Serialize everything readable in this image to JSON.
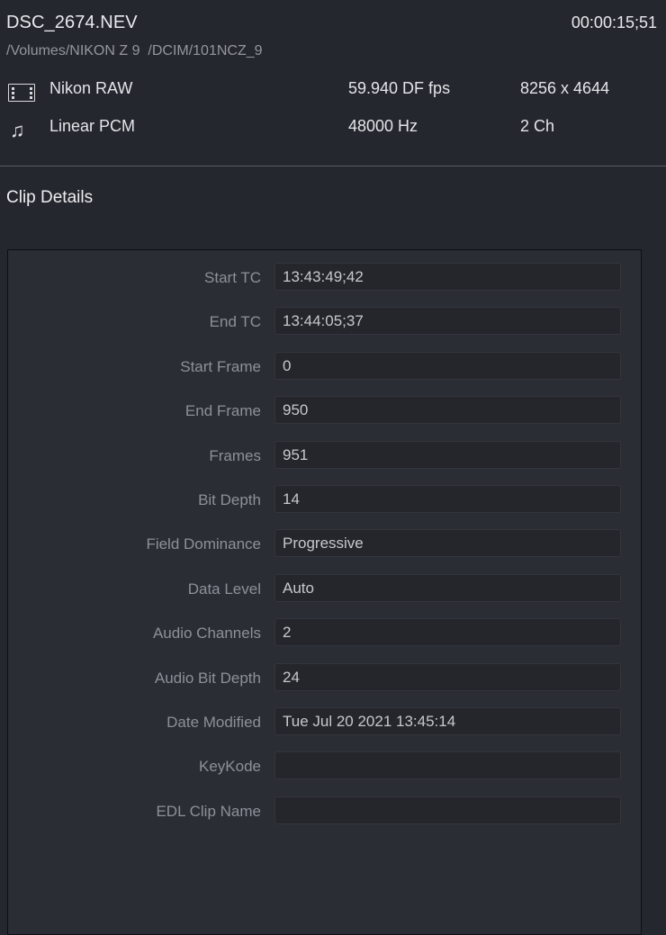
{
  "header": {
    "clip_name": "DSC_2674.NEV",
    "duration": "00:00:15;51",
    "file_path": "/Volumes/NIKON Z 9  /DCIM/101NCZ_9",
    "video": {
      "icon": "film-strip-icon",
      "codec": "Nikon RAW",
      "frame_rate": "59.940 DF fps",
      "resolution": "8256 x 4644"
    },
    "audio": {
      "icon": "music-note-icon",
      "codec": "Linear PCM",
      "sample_rate": "48000 Hz",
      "channels": "2 Ch"
    }
  },
  "section": {
    "title": "Clip Details"
  },
  "fields": [
    {
      "label": "Start TC",
      "value": "13:43:49;42"
    },
    {
      "label": "End TC",
      "value": "13:44:05;37"
    },
    {
      "label": "Start Frame",
      "value": "0"
    },
    {
      "label": "End Frame",
      "value": "950"
    },
    {
      "label": "Frames",
      "value": "951"
    },
    {
      "label": "Bit Depth",
      "value": "14"
    },
    {
      "label": "Field Dominance",
      "value": "Progressive"
    },
    {
      "label": "Data Level",
      "value": "Auto"
    },
    {
      "label": "Audio Channels",
      "value": "2"
    },
    {
      "label": "Audio Bit Depth",
      "value": "24"
    },
    {
      "label": "Date Modified",
      "value": "Tue Jul 20 2021 13:45:14"
    },
    {
      "label": "KeyKode",
      "value": ""
    },
    {
      "label": "EDL Clip Name",
      "value": ""
    }
  ],
  "colors": {
    "background": "#25272e",
    "panel": "#2b2d35",
    "field_background": "#25262c",
    "field_border": "#33353d",
    "panel_border": "#0e0f12",
    "divider": "#5a5d66",
    "text_primary": "#e4e5e9",
    "text_secondary": "#8e9098",
    "text_value": "#c6c8cd"
  }
}
